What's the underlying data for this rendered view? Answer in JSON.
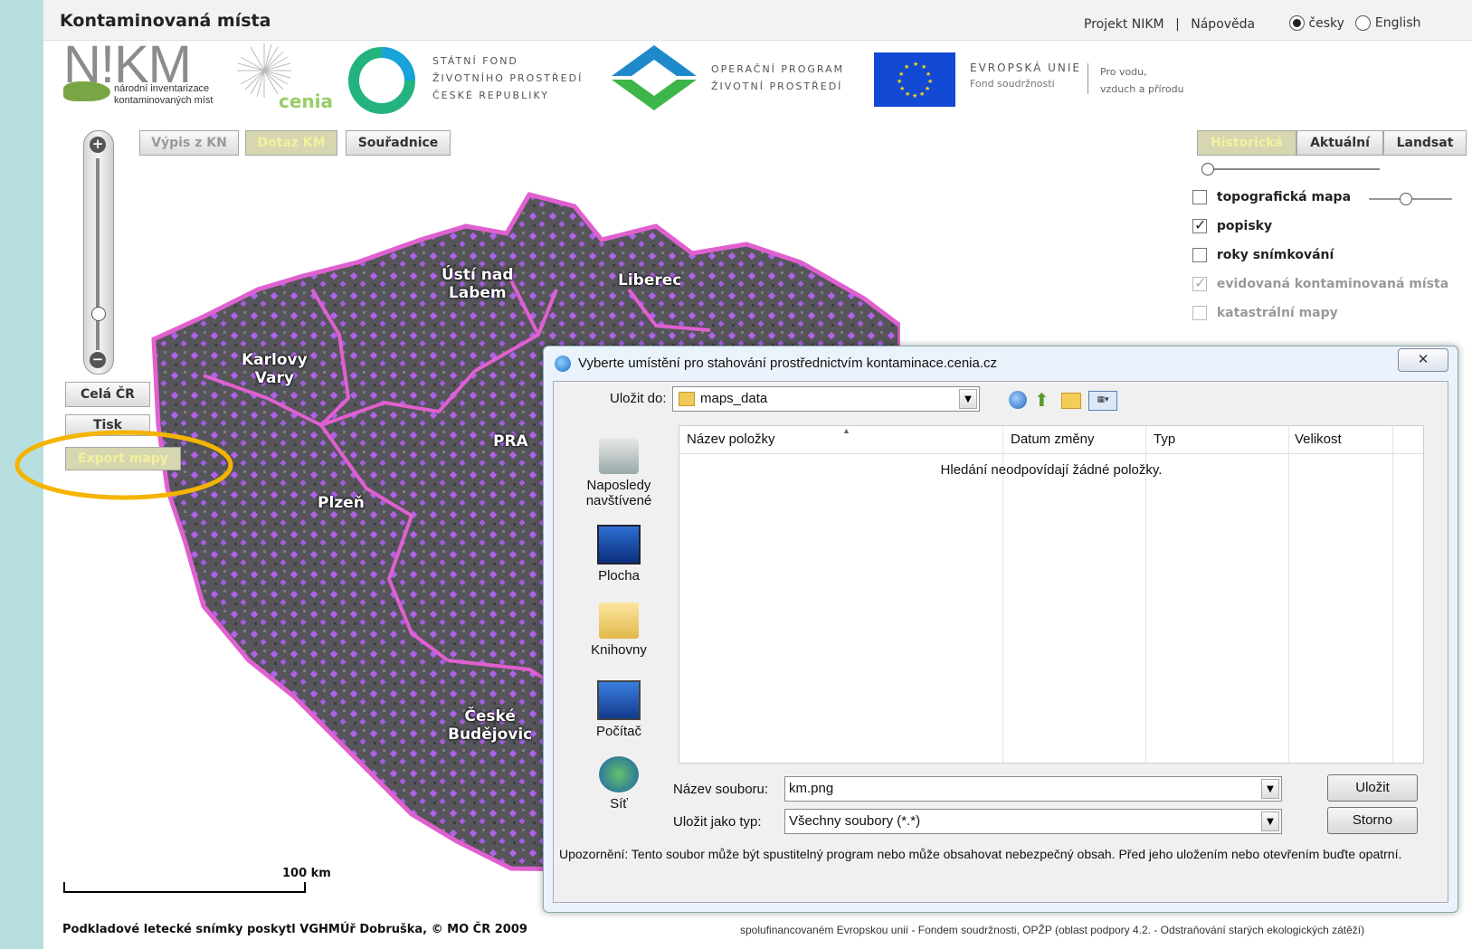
{
  "header": {
    "title": "Kontaminovaná místa",
    "links": [
      "Projekt NIKM",
      "Nápověda"
    ],
    "separator": "|",
    "language_options": [
      {
        "label": "česky",
        "selected": true
      },
      {
        "label": "English",
        "selected": false
      }
    ]
  },
  "logos": {
    "nikm": {
      "name": "N!KM",
      "line1": "národní inventarizace",
      "line2": "kontaminovaných míst"
    },
    "cenia": "cenia",
    "sfzp": [
      "STÁTNÍ FOND",
      "ŽIVOTNÍHO PROSTŘEDÍ",
      "ČESKÉ REPUBLIKY"
    ],
    "op": [
      "OPERAČNÍ PROGRAM",
      "ŽIVOTNÍ PROSTŘEDÍ"
    ],
    "eu": {
      "title": "EVROPSKÁ UNIE",
      "subtitle": "Fond soudržnosti",
      "motto_line1": "Pro vodu,",
      "motto_line2": "vzduch a přírodu"
    }
  },
  "toolbar": {
    "vypis_kn": "Výpis z KN",
    "hidden_button": "Dotaz KM",
    "souradnice": "Souřadnice"
  },
  "left_controls": {
    "zoom_in": "+",
    "zoom_out": "−",
    "cela_cr": "Celá ČR",
    "tisk": "Tisk",
    "export": "Export mapy"
  },
  "basemap": {
    "buttons": [
      "Historická",
      "Aktuální",
      "Landsat"
    ],
    "selected": "Historická"
  },
  "layers": [
    {
      "label": "topografická mapa",
      "checked": false,
      "enabled": true
    },
    {
      "label": "popisky",
      "checked": true,
      "enabled": true
    },
    {
      "label": "roky snímkování",
      "checked": false,
      "enabled": true
    },
    {
      "label": "evidovaná kontaminovaná místa",
      "checked": true,
      "enabled": false
    },
    {
      "label": "katastrální mapy",
      "checked": false,
      "enabled": false
    }
  ],
  "map": {
    "labels": [
      "Ústí nad",
      "Labem",
      "Liberec",
      "Karlovy",
      "Vary",
      "PRA",
      "Plzeň",
      "České",
      "Budějovic"
    ],
    "scale_label": "100 km",
    "attribution": "Podkladové letecké snímky poskytl VGHMÚř Dobruška, © MO ČR 2009",
    "footer_right": "spolufinancovaném Evropskou unií - Fondem soudržnosti, OPŽP (oblast podpory 4.2. - Odstraňování starých ekologických zátěží)"
  },
  "dialog": {
    "title": "Vyberte umístění pro stahování prostřednictvím kontaminace.cenia.cz",
    "close": "✕",
    "save_in_label": "Uložit do:",
    "save_in_value": "maps_data",
    "columns": [
      "Název položky",
      "Datum změny",
      "Typ",
      "Velikost"
    ],
    "empty_message": "Hledání neodpovídají žádné položky.",
    "places": [
      "Naposledy navštívené",
      "Plocha",
      "Knihovny",
      "Počítač",
      "Síť"
    ],
    "filename_label": "Název souboru:",
    "filename_value": "km.png",
    "filetype_label": "Uložit jako typ:",
    "filetype_value": "Všechny soubory (*.*)",
    "save_button": "Uložit",
    "cancel_button": "Storno",
    "warning": "Upozornění: Tento soubor může být spustitelný program nebo může obsahovat nebezpečný obsah. Před jeho uložením nebo otevřením buďte opatrní."
  },
  "colors": {
    "highlight_ellipse": "#f4b400",
    "region_border": "#e060d0",
    "site_marker": "#b060e8"
  }
}
